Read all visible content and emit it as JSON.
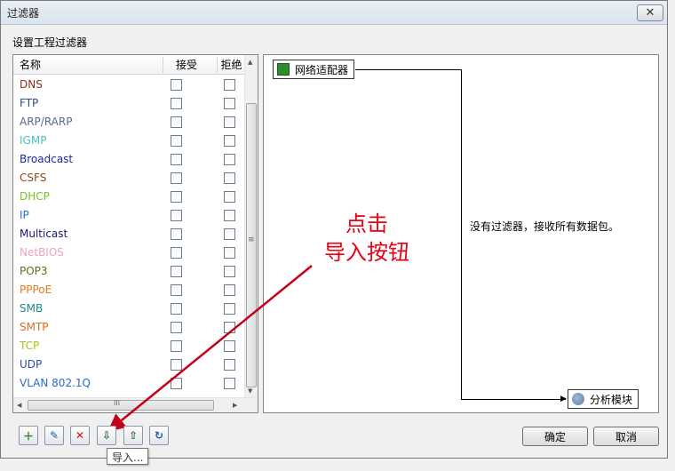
{
  "window": {
    "title": "过滤器"
  },
  "group_label": "设置工程过滤器",
  "table": {
    "headers": {
      "name": "名称",
      "accept": "接受",
      "reject": "拒绝"
    },
    "rows": [
      {
        "name": "DNS",
        "color": "#8b2a1a"
      },
      {
        "name": "FTP",
        "color": "#2c4a9e"
      },
      {
        "name": "ARP/RARP",
        "color": "#5a6a8a"
      },
      {
        "name": "IGMP",
        "color": "#4ac0c0"
      },
      {
        "name": "Broadcast",
        "color": "#1a2a9e"
      },
      {
        "name": "CSFS",
        "color": "#8b4a1a"
      },
      {
        "name": "DHCP",
        "color": "#7ac020"
      },
      {
        "name": "IP",
        "color": "#2a6ad0"
      },
      {
        "name": "Multicast",
        "color": "#1a1a6e"
      },
      {
        "name": "NetBIOS",
        "color": "#f0a0c0"
      },
      {
        "name": "POP3",
        "color": "#6a6a20"
      },
      {
        "name": "PPPoE",
        "color": "#e07a20"
      },
      {
        "name": "SMB",
        "color": "#1a8a8a"
      },
      {
        "name": "SMTP",
        "color": "#e06a2a"
      },
      {
        "name": "TCP",
        "color": "#b0c020"
      },
      {
        "name": "UDP",
        "color": "#2a4ab0"
      },
      {
        "name": "VLAN 802.1Q",
        "color": "#2a6ad0"
      }
    ]
  },
  "diagram": {
    "source_node": "网络适配器",
    "target_node": "分析模块",
    "message": "没有过滤器，接收所有数据包。"
  },
  "annotation": {
    "line1": "点击",
    "line2": "导入按钮",
    "color": "#e60012"
  },
  "toolbar": {
    "tooltip": "导入..."
  },
  "buttons": {
    "ok": "确定",
    "cancel": "取消"
  },
  "scrollbar_glyph": "≡",
  "hscroll_glyph": "III"
}
